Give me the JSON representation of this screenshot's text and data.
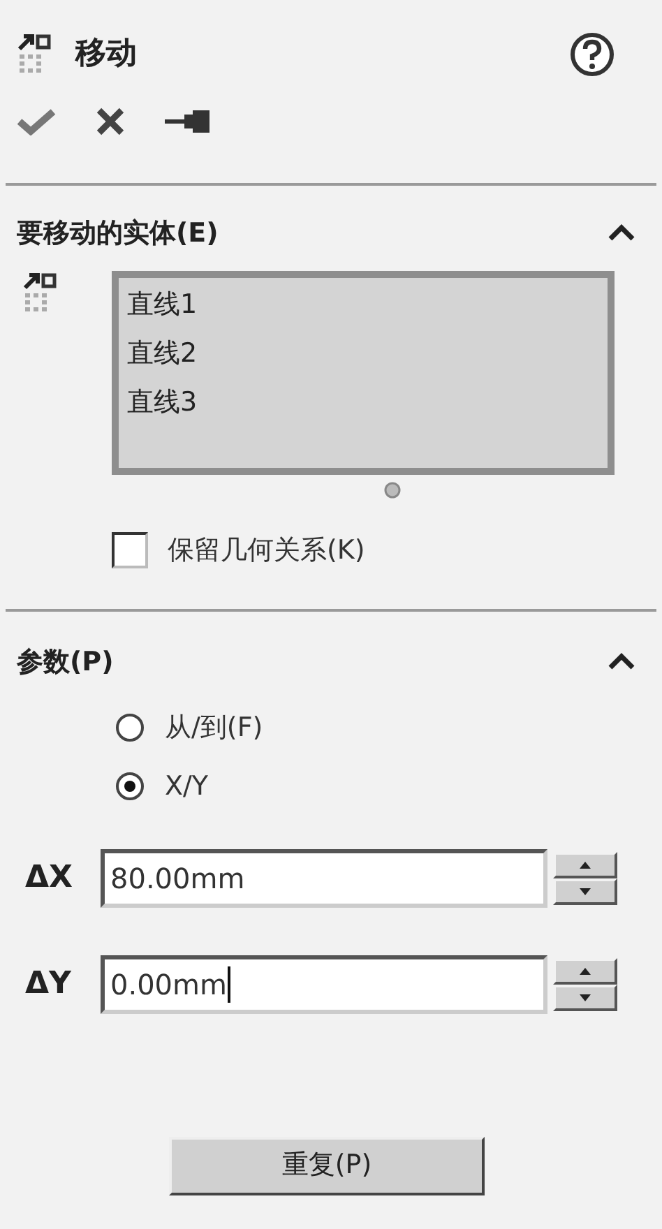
{
  "header": {
    "title": "移动"
  },
  "sections": [
    {
      "title": "要移动的实体(E)",
      "expanded": true,
      "entities": [
        "直线1",
        "直线2",
        "直线3"
      ],
      "checkbox": {
        "label": "保留几何关系(K)",
        "checked": false
      }
    },
    {
      "title": "参数(P)",
      "expanded": true,
      "radios": [
        {
          "label": "从/到(F)",
          "selected": false
        },
        {
          "label": "X/Y",
          "selected": true
        }
      ],
      "fields": [
        {
          "label": "ΔX",
          "value": "80.00mm",
          "focused": false
        },
        {
          "label": "ΔY",
          "value": "0.00mm",
          "focused": true
        }
      ]
    }
  ],
  "button": "重复(P)"
}
